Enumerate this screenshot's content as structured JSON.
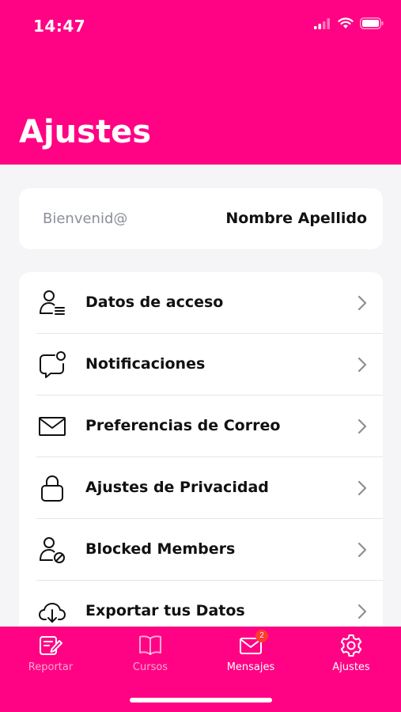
{
  "status_bar": {
    "time": "14:47",
    "icons": [
      "signal-icon",
      "wifi-icon",
      "battery-icon"
    ]
  },
  "header": {
    "title": "Ajustes",
    "color": "#ff0384"
  },
  "welcome": {
    "label": "Bienvenid@",
    "name": "Nombre Apellido"
  },
  "menu": {
    "items": [
      {
        "label": "Datos de acceso",
        "icon": "user-list-icon"
      },
      {
        "label": "Notificaciones",
        "icon": "chat-notification-icon"
      },
      {
        "label": "Preferencias de Correo",
        "icon": "mail-icon"
      },
      {
        "label": "Ajustes de Privacidad",
        "icon": "lock-icon"
      },
      {
        "label": "Blocked Members",
        "icon": "user-blocked-icon"
      },
      {
        "label": "Exportar tus Datos",
        "icon": "cloud-download-icon"
      }
    ]
  },
  "tabbar": {
    "tabs": [
      {
        "label": "Reportar",
        "icon": "report-edit-icon"
      },
      {
        "label": "Cursos",
        "icon": "book-icon"
      },
      {
        "label": "Mensajes",
        "icon": "mail-icon",
        "badge": "2"
      },
      {
        "label": "Ajustes",
        "icon": "gear-icon",
        "active": true
      }
    ]
  }
}
